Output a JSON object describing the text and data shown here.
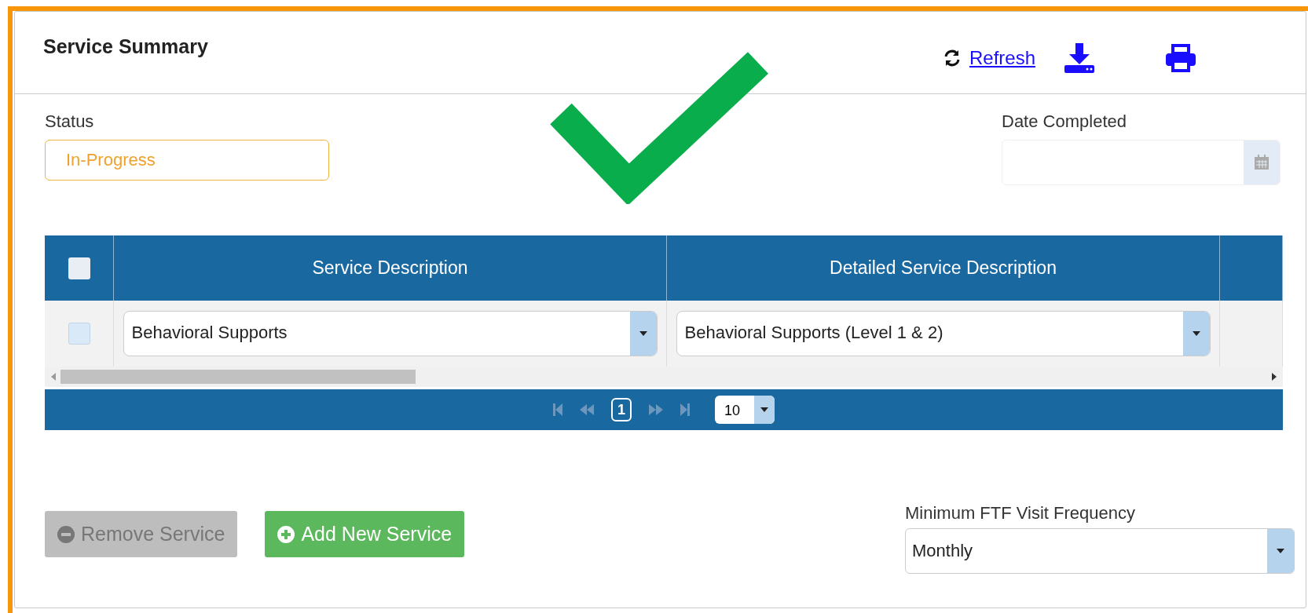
{
  "panel": {
    "title": "Service Summary",
    "refresh_link": "Refresh"
  },
  "status": {
    "label": "Status",
    "value": "In-Progress"
  },
  "date_completed": {
    "label": "Date Completed"
  },
  "table": {
    "header_checkbox": {
      "checked": false
    },
    "columns": [
      "Service Description",
      "Detailed Service Description"
    ],
    "rows": [
      {
        "checked": false,
        "service": "Behavioral Supports",
        "detail": "Behavioral Supports (Level 1 & 2)"
      }
    ],
    "pager": {
      "page": "1",
      "page_size": "10"
    }
  },
  "buttons": [
    {
      "label": "Remove Service",
      "kind": "remove",
      "disabled": true
    },
    {
      "label": "Add New Service",
      "kind": "add",
      "disabled": false
    }
  ],
  "frequency": {
    "label": "Minimum FTF Visit Frequency",
    "value": "Monthly"
  }
}
